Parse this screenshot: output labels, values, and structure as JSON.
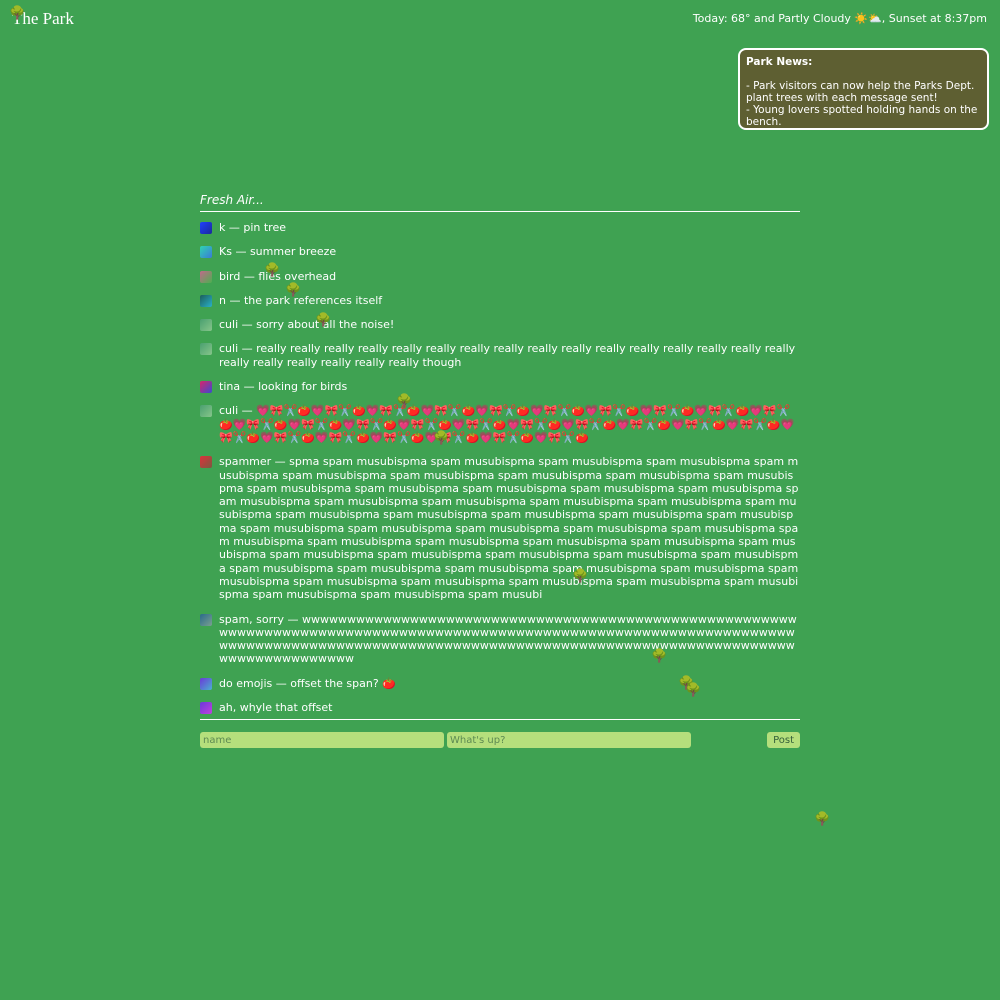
{
  "header": {
    "title": "The Park",
    "weather": "Today: 68° and Partly Cloudy ☀️⛅, Sunset at 8:37pm"
  },
  "news": {
    "title": "Park News:",
    "items": [
      "- Park visitors can now help the Parks Dept. plant trees with each message sent!",
      "- Young lovers spotted holding hands on the bench."
    ]
  },
  "feed": {
    "header": "Fresh Air...",
    "messages": [
      {
        "text": "k — pin tree",
        "avatar": [
          "#1f3fff",
          "#1a2a99"
        ]
      },
      {
        "text": "Ks — summer breeze",
        "avatar": [
          "#2fd4b0",
          "#3a7ad8"
        ]
      },
      {
        "text": "bird — flies overhead",
        "avatar": [
          "#c06a8a",
          "#4caf50"
        ]
      },
      {
        "text": "n — the park references itself",
        "avatar": [
          "#1b5e5a",
          "#2ab0c8"
        ]
      },
      {
        "text": "culi — sorry about all the noise!",
        "avatar": [
          "#4aa070",
          "#86c58a"
        ]
      },
      {
        "text": "culi — really really really really really really really really really really really really really really really really really really really really really really though",
        "avatar": [
          "#4aa070",
          "#86c58a"
        ]
      },
      {
        "text": "tina — looking for birds",
        "avatar": [
          "#d8246b",
          "#3a4bd0"
        ]
      },
      {
        "text": "culi — 💗🎀✂️🍅💗🎀✂️🍅💗🎀✂️🍅💗🎀✂️🍅💗🎀✂️🍅💗🎀✂️🍅💗🎀✂️🍅💗🎀✂️🍅💗🎀✂️🍅💗🎀✂️🍅💗🎀✂️🍅💗🎀✂️🍅💗🎀✂️🍅💗🎀✂️🍅💗🎀✂️🍅💗🎀✂️🍅💗🎀✂️🍅💗🎀✂️🍅💗🎀✂️🍅💗🎀✂️🍅💗🎀✂️🍅💗🎀✂️🍅💗🎀✂️🍅💗🎀✂️🍅💗🎀✂️🍅💗🎀✂️🍅💗🎀✂️🍅",
        "avatar": [
          "#4aa070",
          "#86c58a"
        ]
      },
      {
        "text": "spammer — spma spam musubispma spam musubispma spam musubispma spam musubispma spam musubispma spam musubispma spam musubispma spam musubispma spam musubispma spam musubispma spam musubispma spam musubispma spam musubispma spam musubispma spam musubispma spam musubispma spam musubispma spam musubispma spam musubispma spam musubispma spam musubispma spam musubispma spam musubispma spam musubispma spam musubispma spam musubispma spam musubispma spam musubispma spam musubispma spam musubispma spam musubispma spam musubispma spam musubispma spam musubispma spam musubispma spam musubispma spam musubispma spam musubispma spam musubispma spam musubispma spam musubispma spam musubispma spam musubispma spam musubispma spam musubispma spam musubispma spam musubispma spam musubispma spam musubispma spam musubispma spam musubispma spam musubispma spam musubispma spam musubispma spam musubispma spam musubi",
        "avatar": [
          "#e0303a",
          "#7a5a40"
        ]
      },
      {
        "text": "spam, sorry — wwwwwwwwwwwwwwwwwwwwwwwwwwwwwwwwwwwwwwwwwwwwwwwwwwwwwwwwwwwwwwwwwwwwwwwwwwwwwwwwwwwwwwwwwwwwwwwwwwwwwwwwwwwwwwwwwwwwwwwwwwwwwwwwwwwwwwwwwwwwwwwwwwwwwwwwwwwwwwwwwwwwwwwwwwwwwwwwwwwwwwwwwwwwwwwwwwwwww",
        "avatar": [
          "#2a6a8a",
          "#7aa090"
        ]
      },
      {
        "text": "do emojis — offset the span? 🍅",
        "avatar": [
          "#6a3ad8",
          "#4ab0d0"
        ]
      },
      {
        "text": "ah, whyle that offset",
        "avatar": [
          "#6a3ad8",
          "#c040e0"
        ]
      }
    ]
  },
  "composer": {
    "name_placeholder": "name",
    "message_placeholder": "What's up?",
    "post_label": "Post"
  },
  "decor": {
    "tree_icon": "🌳"
  }
}
